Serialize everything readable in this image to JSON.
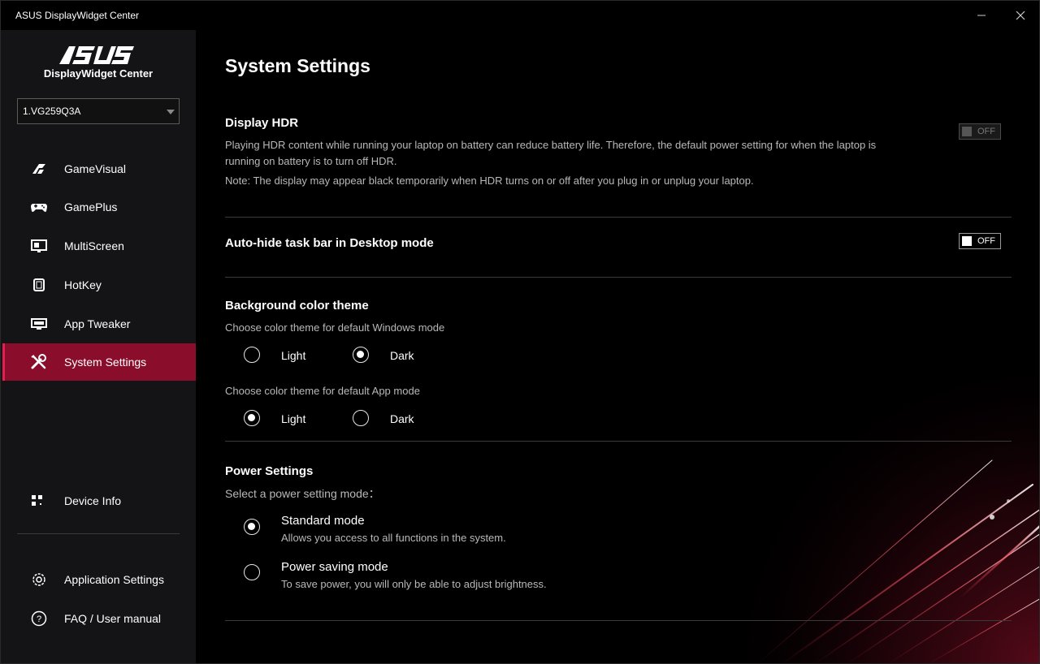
{
  "window": {
    "title": "ASUS DisplayWidget Center",
    "minimize_icon": "minimize-icon",
    "close_icon": "close-icon"
  },
  "sidebar": {
    "logo_text": "ASUS",
    "brand_subtitle": "DisplayWidget Center",
    "device_selected": "1.VG259Q3A",
    "nav": [
      {
        "label": "GameVisual",
        "icon": "gamevisual-icon"
      },
      {
        "label": "GamePlus",
        "icon": "gamepad-icon"
      },
      {
        "label": "MultiScreen",
        "icon": "monitor-icon"
      },
      {
        "label": "HotKey",
        "icon": "hotkey-icon"
      },
      {
        "label": "App Tweaker",
        "icon": "app-tweaker-icon"
      },
      {
        "label": "System Settings",
        "icon": "tools-icon",
        "active": true
      }
    ],
    "device_info": "Device Info",
    "app_settings": "Application Settings",
    "faq": "FAQ / User manual"
  },
  "main": {
    "page_title": "System Settings",
    "hdr": {
      "title": "Display HDR",
      "desc_line1": "Playing HDR content while running your laptop on battery can reduce battery life. Therefore, the default power setting for when the laptop is",
      "desc_line2": "running on battery is to turn off HDR.",
      "note": "Note: The display may appear black temporarily when HDR turns on or off after you plug in or unplug your laptop.",
      "toggle_label": "OFF",
      "enabled": false
    },
    "autohide": {
      "title": "Auto-hide task bar in Desktop mode",
      "toggle_label": "OFF"
    },
    "theme": {
      "title": "Background color theme",
      "windows_label": "Choose color theme for default Windows mode",
      "app_label": "Choose color theme for default App mode",
      "light": "Light",
      "dark": "Dark",
      "windows_selected": "Dark",
      "app_selected": "Light"
    },
    "power": {
      "title": "Power Settings",
      "prompt": "Select a power setting mode：",
      "standard_title": "Standard mode",
      "standard_desc": "Allows you access to all functions in the system.",
      "saving_title": "Power saving mode",
      "saving_desc": "To save power, you will only be able to adjust brightness.",
      "selected": "Standard mode"
    }
  },
  "colors": {
    "accent": "#8a0e2c",
    "accent_bright": "#e41e50",
    "sidebar_bg": "#141416",
    "main_bg": "#000000",
    "secondary_text": "#b8b8b8"
  }
}
